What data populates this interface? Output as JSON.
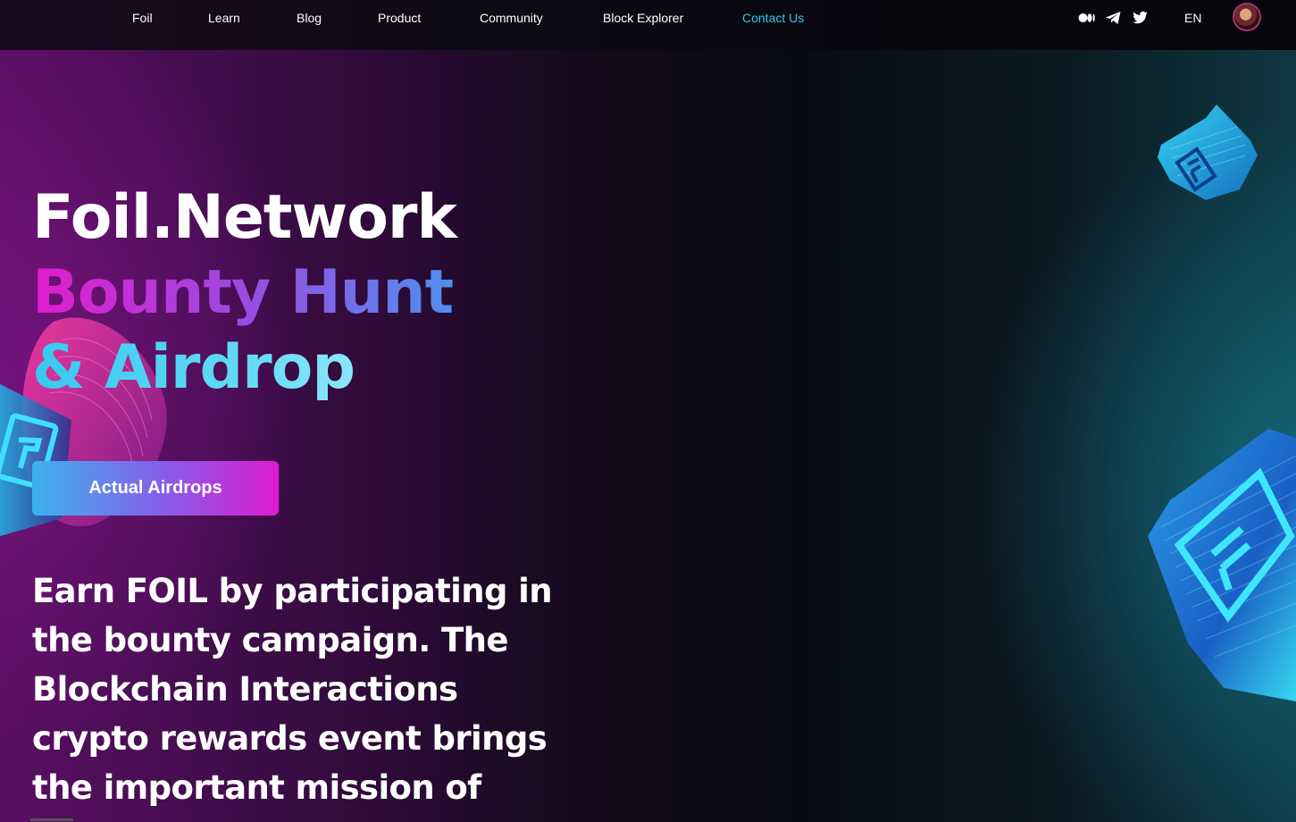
{
  "nav": {
    "items": [
      {
        "label": "Foil"
      },
      {
        "label": "Learn"
      },
      {
        "label": "Blog"
      },
      {
        "label": "Product"
      },
      {
        "label": "Community"
      },
      {
        "label": "Block Explorer"
      },
      {
        "label": "Contact Us",
        "active": true
      }
    ],
    "social": [
      "medium-icon",
      "telegram-icon",
      "twitter-icon"
    ],
    "language": "EN"
  },
  "hero": {
    "title_line1": "Foil.Network",
    "title_line2": "Bounty Hunt",
    "title_line3": "& Airdrop",
    "cta_label": "Actual Airdrops",
    "description": "Earn FOIL by participating in the bounty campaign. The Blockchain Interactions crypto rewards event brings the important mission of"
  },
  "colors": {
    "accent_cyan": "#33c7e6",
    "accent_magenta": "#e21ccd",
    "accent_blue": "#4f8ff0"
  }
}
